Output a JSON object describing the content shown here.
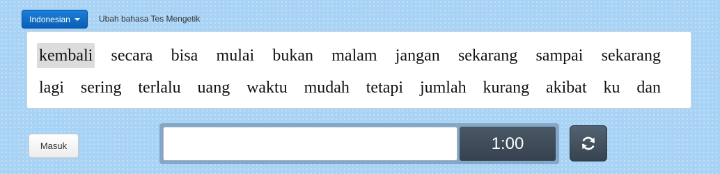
{
  "language_selector": {
    "label": "Indonesian",
    "caret_icon": "caret-down-icon"
  },
  "change_language_text": "Ubah bahasa Tes Mengetik",
  "words": {
    "line1": [
      "kembali",
      "secara",
      "bisa",
      "mulai",
      "bukan",
      "malam",
      "jangan",
      "sekarang",
      "sampai",
      "sekarang"
    ],
    "line2": [
      "lagi",
      "sering",
      "terlalu",
      "uang",
      "waktu",
      "mudah",
      "tetapi",
      "jumlah",
      "kurang",
      "akibat",
      "ku",
      "dan"
    ]
  },
  "login_button": "Masuk",
  "typing_input": {
    "value": "",
    "placeholder": ""
  },
  "timer": "1:00",
  "reload_button": {
    "icon": "refresh-icon"
  },
  "colors": {
    "accent": "#0a5fb6",
    "background": "#a9d3f4",
    "timer_bg": "#3e4a57",
    "highlight": "#dcdcdc"
  }
}
